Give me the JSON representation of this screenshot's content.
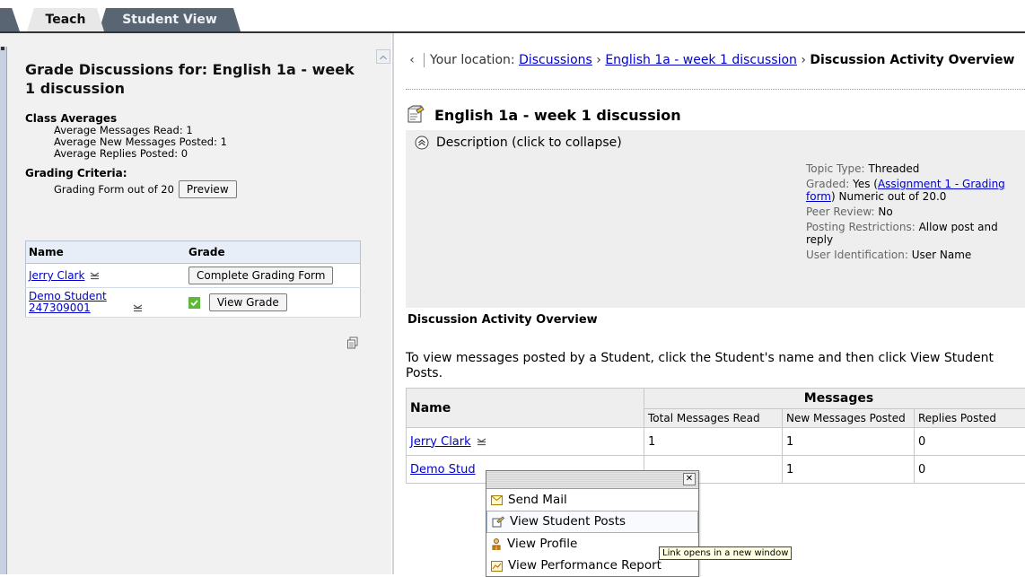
{
  "tabs": [
    {
      "label": "Teach"
    },
    {
      "label": "Student View"
    }
  ],
  "left": {
    "title": "Grade Discussions for: English 1a - week 1 discussion",
    "class_averages": {
      "heading": "Class Averages",
      "rows": [
        "Average Messages Read: 1",
        "Average New Messages Posted: 1",
        "Average Replies Posted: 0"
      ]
    },
    "grading_criteria": {
      "heading": "Grading Criteria:",
      "text": "Grading Form out of 20",
      "preview_button": "Preview"
    },
    "table": {
      "headers": [
        "Name",
        "Grade"
      ],
      "rows": [
        {
          "name": "Jerry Clark",
          "action": "Complete Grading Form"
        },
        {
          "name": "Demo Student 247309001",
          "action": "View Grade"
        }
      ]
    }
  },
  "right": {
    "breadcrumb": {
      "prefix": "Your location:",
      "links": [
        "Discussions",
        "English 1a - week 1 discussion"
      ],
      "current": "Discussion Activity Overview"
    },
    "topic_title": "English 1a - week 1 discussion",
    "description_toggle": "Description (click to collapse)",
    "details": [
      {
        "label": "Topic Type:",
        "value": "Threaded"
      },
      {
        "label": "Graded:",
        "value": "Yes",
        "link": "Assignment 1 - Grading form",
        "suffix": "Numeric out of 20.0"
      },
      {
        "label": "Peer Review:",
        "value": "No"
      },
      {
        "label": "Posting Restrictions:",
        "value": "Allow post and reply"
      },
      {
        "label": "User Identification:",
        "value": "User Name"
      }
    ],
    "section_heading": "Discussion Activity Overview",
    "instructions": "To view messages posted by a Student, click the Student's name and then click View Student Posts.",
    "table": {
      "name_header": "Name",
      "group_header": "Messages",
      "columns": [
        "Total Messages Read",
        "New Messages Posted",
        "Replies Posted"
      ],
      "rows": [
        {
          "name": "Jerry Clark",
          "read": "1",
          "posted": "1",
          "replies": "0"
        },
        {
          "name": "Demo Stud",
          "read": "",
          "posted": "1",
          "replies": "0"
        }
      ]
    }
  },
  "context_menu": {
    "items": [
      "Send Mail",
      "View Student Posts",
      "View Profile",
      "View Performance Report"
    ],
    "tooltip": "Link opens in a new window"
  }
}
